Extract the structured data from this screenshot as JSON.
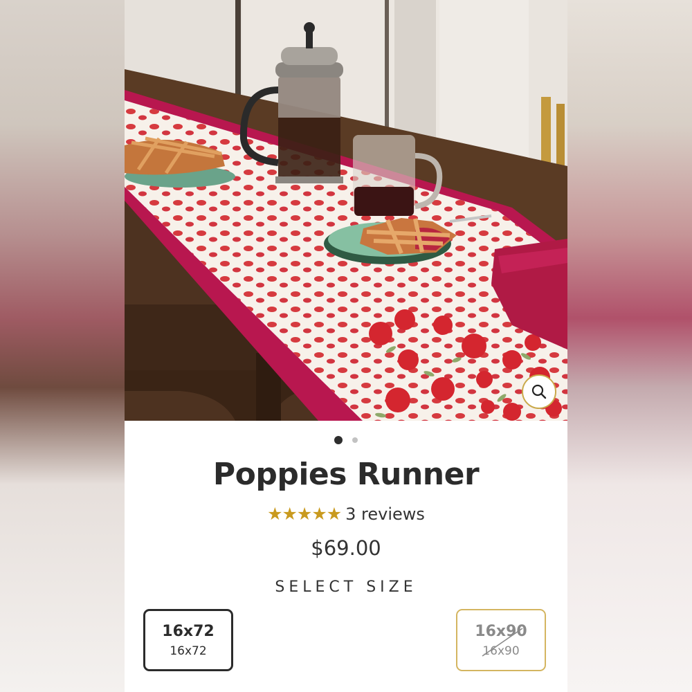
{
  "product": {
    "title": "Poppies Runner",
    "rating_stars": "★★★★★",
    "reviews_label": "3 reviews",
    "price": "$69.00"
  },
  "gallery": {
    "image_count": 2,
    "active_index": 0,
    "zoom_icon": "search-icon"
  },
  "size_selector": {
    "heading": "SELECT SIZE",
    "options": [
      {
        "label": "16x72",
        "sublabel": "16x72",
        "state": "selected"
      },
      {
        "label": "16x90",
        "sublabel": "16x90",
        "state": "unavailable"
      }
    ]
  },
  "colors": {
    "accent_gold": "#c9a94a",
    "star_gold": "#c99a1e",
    "runner_pink": "#c0195a",
    "poppy_red": "#d42a32"
  }
}
